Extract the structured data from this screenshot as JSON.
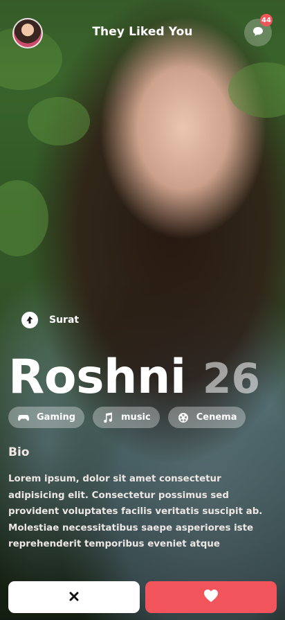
{
  "header": {
    "title": "They Liked You",
    "message_count": "44"
  },
  "profile": {
    "location": "Surat",
    "name": "Roshni",
    "age": "26",
    "interests": [
      {
        "label": "Gaming",
        "icon": "gamepad-icon"
      },
      {
        "label": "music",
        "icon": "music-icon"
      },
      {
        "label": "Cenema",
        "icon": "film-icon"
      }
    ],
    "bio_title": "Bio",
    "bio_text": "Lorem ipsum, dolor sit amet consectetur adipisicing elit. Consectetur possimus sed provident voluptates facilis veritatis suscipit ab. Molestiae necessitatibus saepe asperiores iste reprehenderit temporibus eveniet atque"
  },
  "actions": {
    "pass_icon": "close-icon",
    "like_icon": "heart-icon"
  },
  "colors": {
    "accent": "#f2545b",
    "white": "#ffffff"
  }
}
